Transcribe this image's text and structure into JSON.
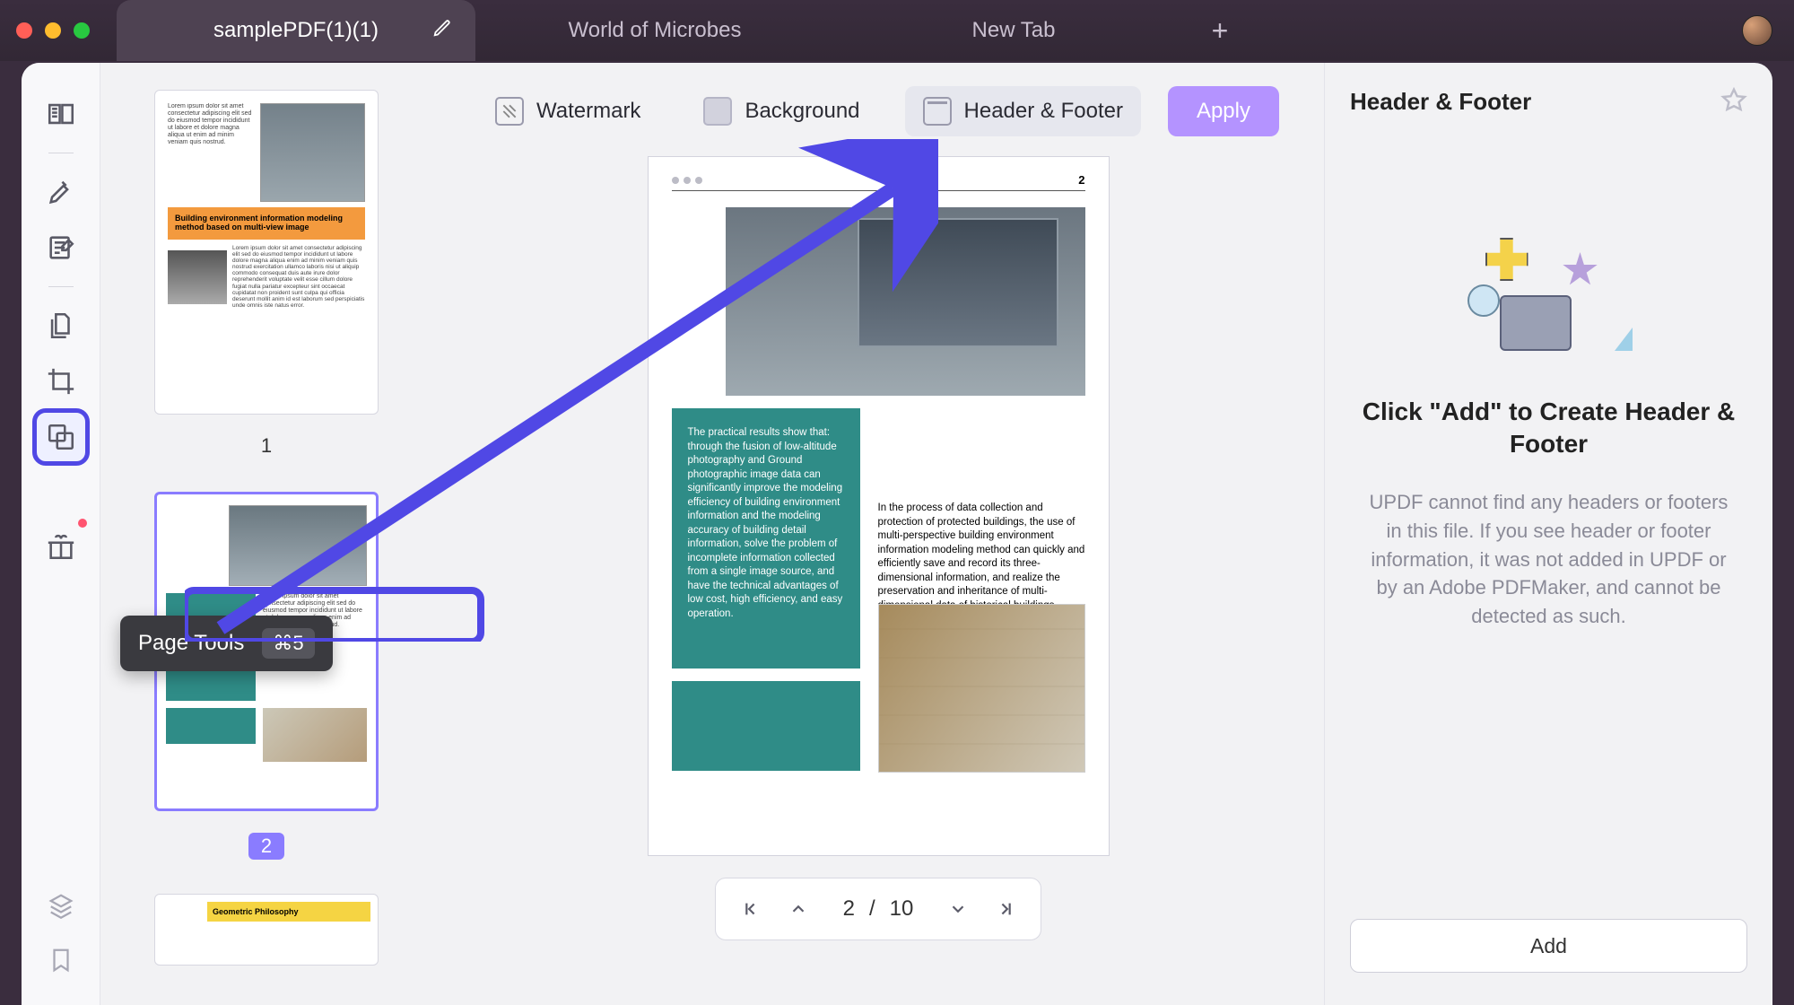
{
  "tabs": [
    {
      "label": "samplePDF(1)(1)",
      "active": true
    },
    {
      "label": "World of Microbes",
      "active": false
    },
    {
      "label": "New Tab",
      "active": false
    }
  ],
  "toolbar": {
    "watermark": "Watermark",
    "background": "Background",
    "header_footer": "Header & Footer",
    "apply": "Apply"
  },
  "tooltip": {
    "label": "Page Tools",
    "shortcut": "⌘5"
  },
  "thumbs": {
    "page1_num": "1",
    "page2_num": "2",
    "page1_title": "Building environment information modeling method based on multi-view image",
    "page3_title": "Geometric Philosophy"
  },
  "page": {
    "number": "2",
    "teal_text": "The practical results show that: through the fusion of low-altitude photography and Ground photographic image data can significantly improve the modeling efficiency of building environment information and the modeling accuracy of building detail information, solve the problem of incomplete information collected from a single image source, and have the technical advantages of low cost, high efficiency, and easy operation.",
    "right_text": "In the process of data collection and protection of protected buildings, the use of multi-perspective building environment information modeling method can quickly and efficiently save and record its three-dimensional information, and realize the preservation and inheritance of multi-dimensional data of historical buildings."
  },
  "pager": {
    "current": "2",
    "sep": "/",
    "total": "10"
  },
  "right": {
    "title": "Header & Footer",
    "headline": "Click \"Add\" to Create Header & Footer",
    "desc": "UPDF cannot find any headers or footers in this file. If you see header or footer information, it was not added in UPDF or by an Adobe PDFMaker, and cannot be detected as such.",
    "add": "Add"
  }
}
